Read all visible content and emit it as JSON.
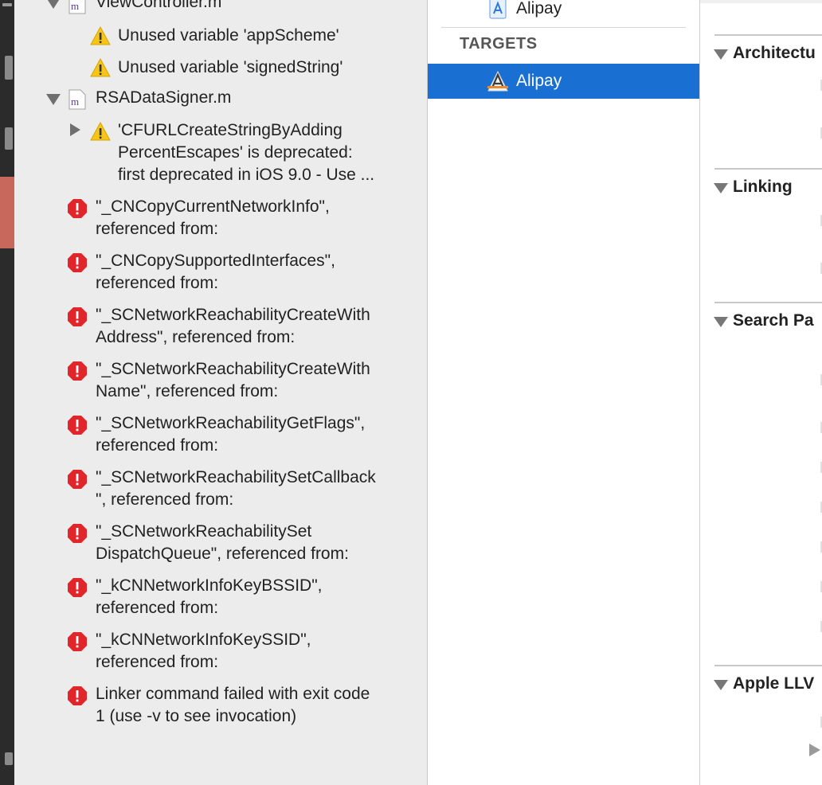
{
  "issue_navigator": {
    "file_1": {
      "name": "ViewController.m"
    },
    "warnings_1": [
      {
        "text": "Unused variable 'appScheme'"
      },
      {
        "text": "Unused variable 'signedString'"
      }
    ],
    "file_2": {
      "name": "RSADataSigner.m"
    },
    "deprecation": {
      "text": "'CFURLCreateStringByAdding\nPercentEscapes' is deprecated:\nfirst deprecated in iOS 9.0 - Use ..."
    },
    "errors": [
      {
        "text": "\"_CNCopyCurrentNetworkInfo\",\nreferenced from:"
      },
      {
        "text": "\"_CNCopySupportedInterfaces\",\nreferenced from:"
      },
      {
        "text": "\"_SCNetworkReachabilityCreateWith\nAddress\", referenced from:"
      },
      {
        "text": "\"_SCNetworkReachabilityCreateWith\nName\", referenced from:"
      },
      {
        "text": "\"_SCNetworkReachabilityGetFlags\",\nreferenced from:"
      },
      {
        "text": "\"_SCNetworkReachabilitySetCallback\n\", referenced from:"
      },
      {
        "text": "\"_SCNetworkReachabilitySet\nDispatchQueue\", referenced from:"
      },
      {
        "text": "\"_kCNNetworkInfoKeyBSSID\",\nreferenced from:"
      },
      {
        "text": "\"_kCNNetworkInfoKeySSID\",\nreferenced from:"
      },
      {
        "text": "Linker command failed with exit code\n1 (use -v to see invocation)"
      }
    ]
  },
  "targets_panel": {
    "project_name": "Alipay",
    "targets_header": "TARGETS",
    "selected_target": "Alipay"
  },
  "build_settings": {
    "sections": [
      {
        "title": "Architectu"
      },
      {
        "title": "Linking"
      },
      {
        "title": "Search Pa"
      },
      {
        "title": "Apple LLV"
      }
    ]
  },
  "colors": {
    "selection_blue": "#1a6fd3",
    "error_red": "#e0262b",
    "warning_yellow": "#f5c518",
    "sidebar_bg": "#ececec"
  }
}
